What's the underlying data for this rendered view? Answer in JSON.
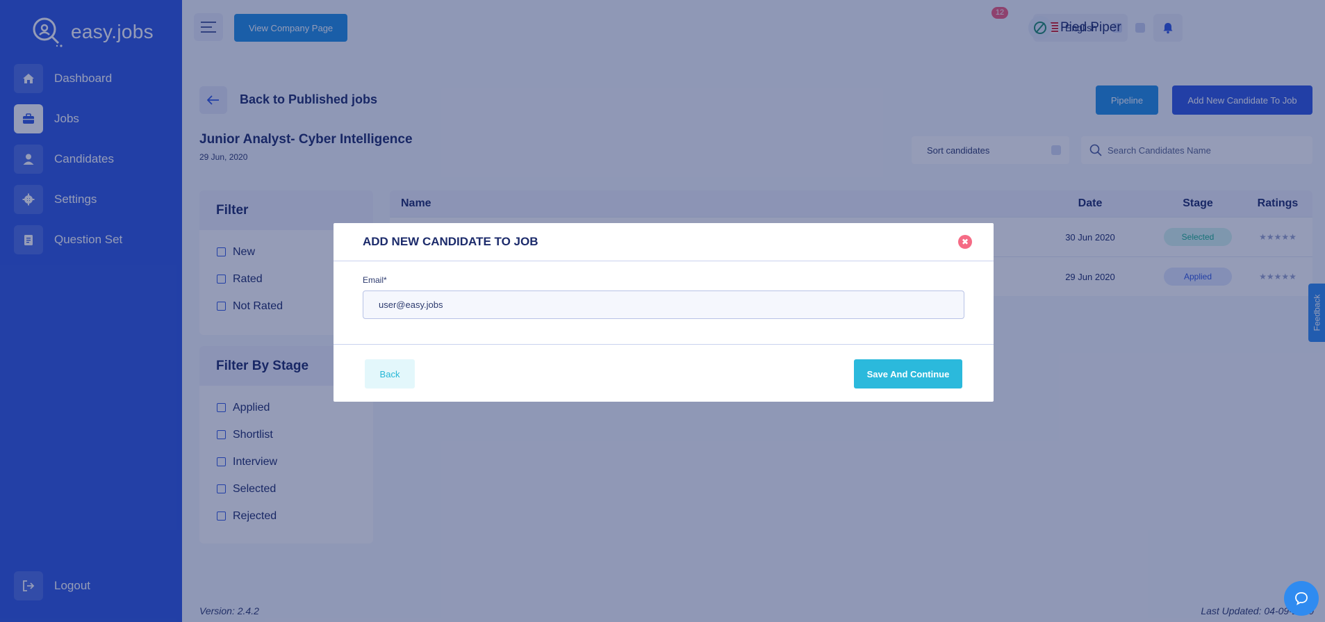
{
  "app": {
    "logo_text": "easy.jobs"
  },
  "sidebar": {
    "items": [
      {
        "label": "Dashboard",
        "icon": "home-icon"
      },
      {
        "label": "Jobs",
        "icon": "briefcase-icon",
        "active": true
      },
      {
        "label": "Candidates",
        "icon": "user-icon"
      },
      {
        "label": "Settings",
        "icon": "gear-icon"
      },
      {
        "label": "Question Set",
        "icon": "clipboard-icon"
      }
    ],
    "logout_label": "Logout"
  },
  "header": {
    "view_company_label": "View Company Page",
    "language": "English",
    "notification_count": "12",
    "company_name": "Pied Piper"
  },
  "job": {
    "back_label": "Back to Published jobs",
    "title": "Junior Analyst- Cyber Intelligence",
    "date": "29 Jun, 2020",
    "pipeline_label": "Pipeline",
    "add_candidate_label": "Add New Candidate To Job",
    "sort_placeholder": "Sort candidates",
    "search_placeholder": "Search Candidates Name"
  },
  "filters": {
    "title": "Filter",
    "options": [
      "New",
      "Rated",
      "Not Rated"
    ],
    "stage_title": "Filter By Stage",
    "stage_options": [
      "Applied",
      "Shortlist",
      "Interview",
      "Selected",
      "Rejected"
    ]
  },
  "table": {
    "headers": {
      "name": "Name",
      "date": "Date",
      "stage": "Stage",
      "ratings": "Ratings"
    },
    "rows": [
      {
        "date": "30 Jun 2020",
        "stage": "Selected",
        "rating": 0
      },
      {
        "date": "29 Jun 2020",
        "stage": "Applied",
        "rating": 0
      }
    ],
    "rating_stars": "★★★★★"
  },
  "footer": {
    "version": "Version: 2.4.2",
    "last_updated": "Last Updated: 04-09-2020"
  },
  "feedback_label": "Feedback",
  "modal": {
    "title": "ADD NEW CANDIDATE TO JOB",
    "email_label": "Email*",
    "email_value": "user@easy.jobs",
    "back_label": "Back",
    "save_label": "Save And Continue",
    "close_glyph": "✖"
  },
  "colors": {
    "sidebar": "#2f57e0",
    "primary": "#2f57e0",
    "secondary": "#1f8fe4",
    "save": "#2bb9dc",
    "close": "#f56b85"
  }
}
